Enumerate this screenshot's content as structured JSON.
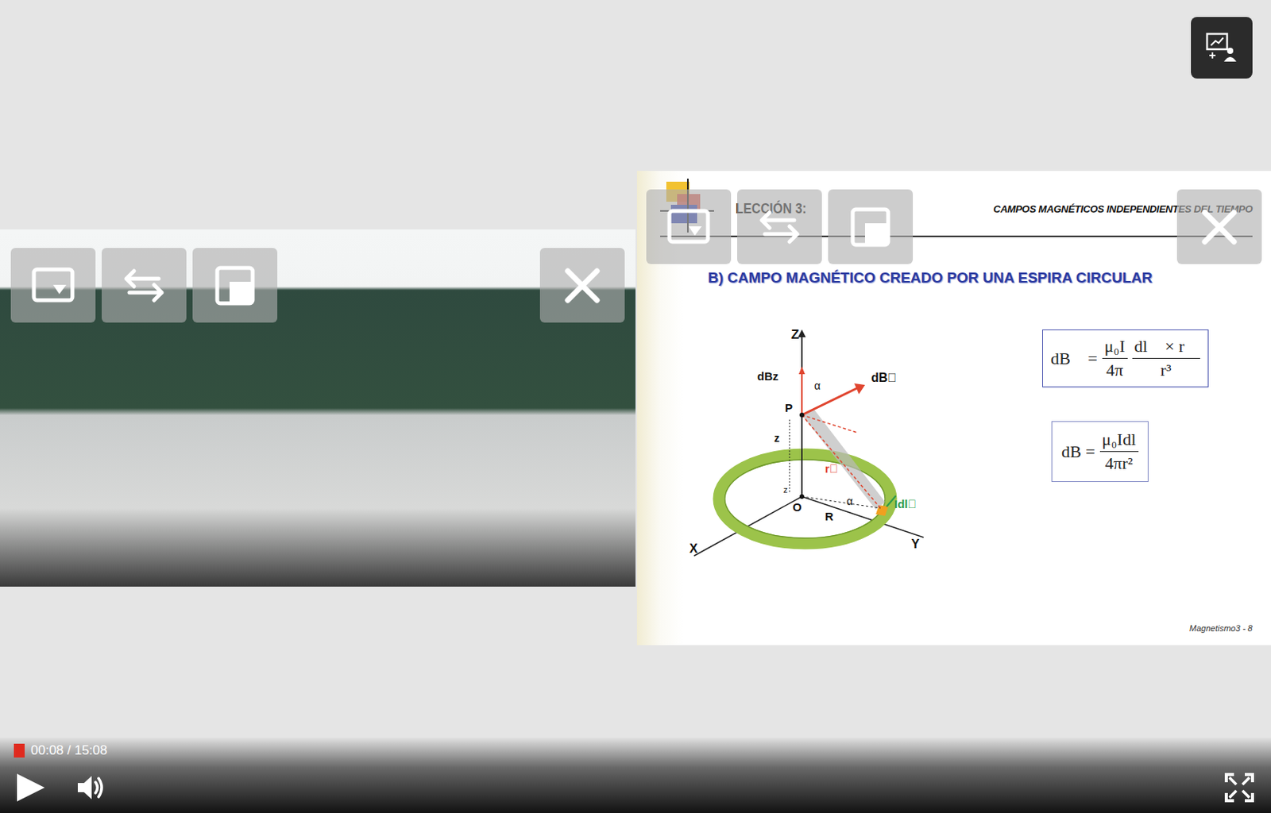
{
  "slide": {
    "lesson": "LECCIÓN 3:",
    "course_title": "CAMPOS MAGNÉTICOS INDEPENDIENTES DEL TIEMPO",
    "title": "B) CAMPO MAGNÉTICO CREADO POR UNA ESPIRA CIRCULAR",
    "diagram_labels": [
      {
        "text": "Z",
        "color": "#111111"
      },
      {
        "text": "dBz",
        "color": "#111111"
      },
      {
        "text": "α",
        "color": "#111111"
      },
      {
        "text": "dB⃗",
        "color": "#111111"
      },
      {
        "text": "P",
        "color": "#111111"
      },
      {
        "text": "z",
        "color": "#111111"
      },
      {
        "text": "z",
        "color": "#111111"
      },
      {
        "text": "r⃗",
        "color": "#e0452f"
      },
      {
        "text": "O",
        "color": "#111111"
      },
      {
        "text": "R",
        "color": "#111111"
      },
      {
        "text": "α",
        "color": "#111111"
      },
      {
        "text": "Idl⃗",
        "color": "#2a9a4a"
      },
      {
        "text": "X",
        "color": "#111111"
      },
      {
        "text": "Y",
        "color": "#111111"
      }
    ],
    "formula_vector": {
      "lhs": "dB⃗ =",
      "coef_num": "μ₀I",
      "coef_den": "4π",
      "frac_num": "dl⃗ × r⃗",
      "frac_den": "r³"
    },
    "formula_scalar": {
      "lhs": "dB =",
      "num": "μ₀Idl",
      "den": "4πr²"
    },
    "footer": "Magnetismo3 - 8"
  },
  "playback": {
    "time": "00:08 / 15:08",
    "progress": 0.009,
    "playing": false
  }
}
